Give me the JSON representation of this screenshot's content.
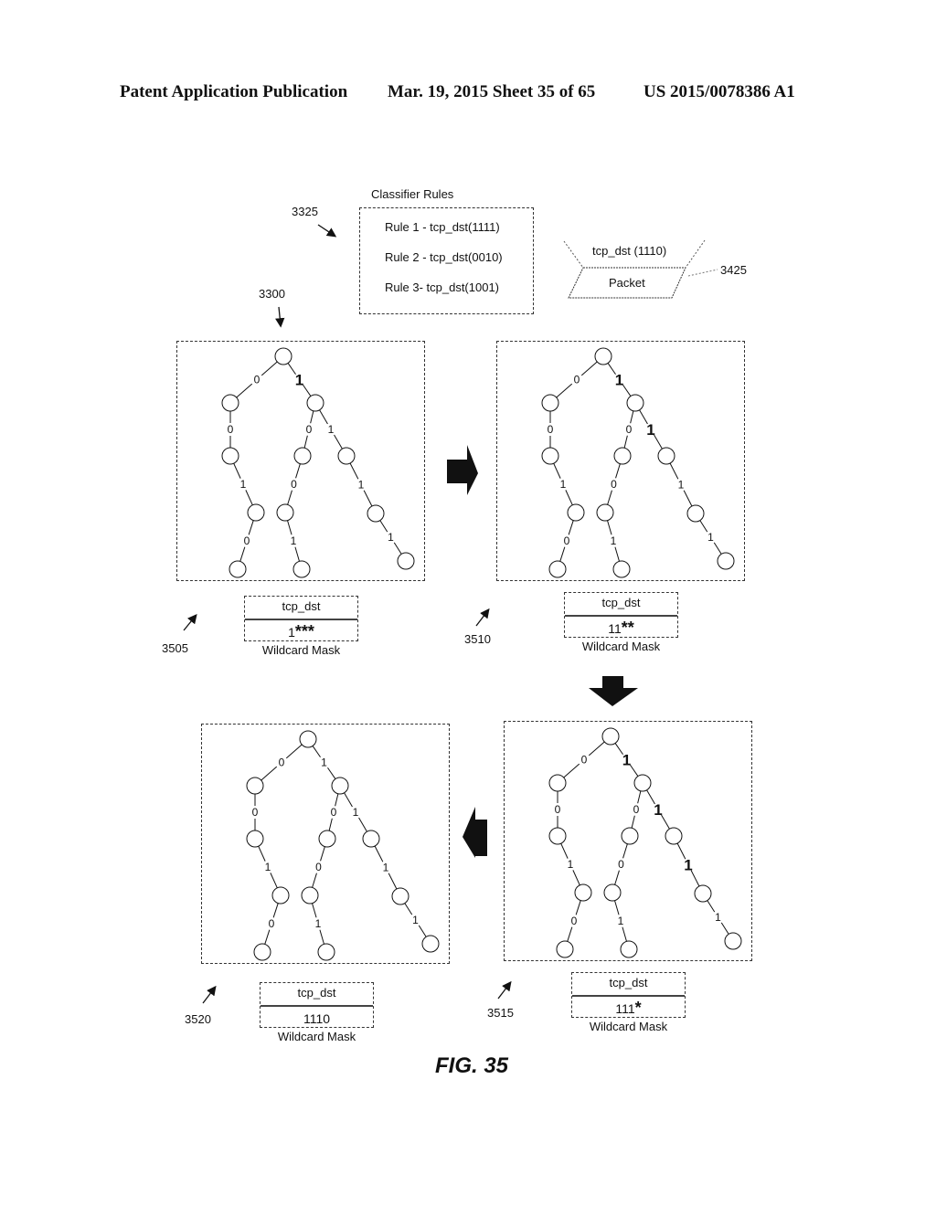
{
  "header": {
    "left": "Patent Application Publication",
    "center": "Mar. 19, 2015  Sheet 35 of 65",
    "right": "US 2015/0078386 A1"
  },
  "classifier": {
    "title": "Classifier Rules",
    "ref": "3325",
    "rules": [
      "Rule 1 - tcp_dst(1111)",
      "Rule 2 - tcp_dst(0010)",
      "Rule 3- tcp_dst(1001)"
    ]
  },
  "packet": {
    "field": "tcp_dst (1110)",
    "label": "Packet",
    "ref": "3425"
  },
  "tree_ref": "3300",
  "stages": [
    {
      "ref": "3505",
      "mask_header": "tcp_dst",
      "mask_prefix": "1",
      "mask_stars": "***",
      "caption": "Wildcard Mask",
      "bold_edges": [
        "r-R"
      ]
    },
    {
      "ref": "3510",
      "mask_header": "tcp_dst",
      "mask_prefix": "11",
      "mask_stars": "**",
      "caption": "Wildcard Mask",
      "bold_edges": [
        "r-R",
        "R-RR"
      ]
    },
    {
      "ref": "3515",
      "mask_header": "tcp_dst",
      "mask_prefix": "111",
      "mask_stars": "*",
      "caption": "Wildcard Mask",
      "bold_edges": [
        "r-R",
        "R-RR",
        "RR-RRR"
      ]
    },
    {
      "ref": "3520",
      "mask_header": "tcp_dst",
      "mask_prefix": "1110",
      "mask_stars": "",
      "caption": "Wildcard Mask",
      "bold_edges": []
    }
  ],
  "tree": {
    "edges": [
      {
        "id": "r-L",
        "bit": "0"
      },
      {
        "id": "r-R",
        "bit": "1"
      },
      {
        "id": "L-LL",
        "bit": "0"
      },
      {
        "id": "LL-LLR",
        "bit": "1"
      },
      {
        "id": "LLR-LLRL",
        "bit": "0"
      },
      {
        "id": "R-RL",
        "bit": "0"
      },
      {
        "id": "RL-RLL",
        "bit": "0"
      },
      {
        "id": "RLL-RLLR",
        "bit": "1"
      },
      {
        "id": "R-RR",
        "bit": "1"
      },
      {
        "id": "RR-RRR",
        "bit": "1"
      },
      {
        "id": "RRR-RRRR",
        "bit": "1"
      }
    ]
  },
  "figure_label": "FIG. 35"
}
